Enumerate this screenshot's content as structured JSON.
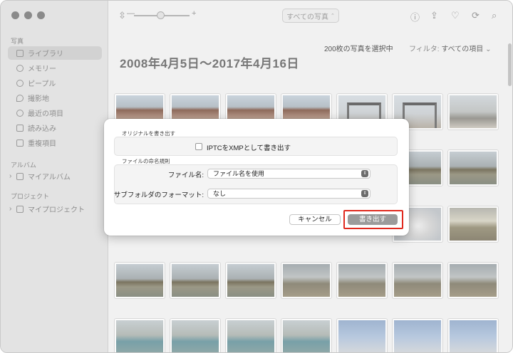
{
  "sidebar": {
    "section_library": "写真",
    "library_items": [
      {
        "label": "ライブラリ",
        "icon": "photo-library-icon"
      },
      {
        "label": "メモリー",
        "icon": "memories-icon"
      },
      {
        "label": "ピープル",
        "icon": "people-icon"
      },
      {
        "label": "撮影地",
        "icon": "location-pin-icon"
      },
      {
        "label": "最近の項目",
        "icon": "clock-icon"
      },
      {
        "label": "読み込み",
        "icon": "import-icon"
      },
      {
        "label": "重複項目",
        "icon": "duplicates-icon"
      }
    ],
    "section_albums": "アルバム",
    "my_albums": "マイアルバム",
    "section_projects": "プロジェクト",
    "my_projects": "マイプロジェクト"
  },
  "toolbar": {
    "zoom_minus": "—",
    "zoom_plus": "+",
    "view_select": "すべての写真"
  },
  "main": {
    "selection_info": "200枚の写真を選択中",
    "filter_label": "フィルタ:",
    "filter_value": "すべての項目",
    "date_range": "2008年4月5日〜2017年4月16日"
  },
  "dialog": {
    "original_group_label": "オリジナルを書き出す",
    "iptc_checkbox_label": "IPTCをXMPとして書き出す",
    "iptc_checked": false,
    "naming_group_label": "ファイルの命名規則",
    "filename_label": "ファイル名:",
    "filename_value": "ファイル名を使用",
    "subfolder_label": "サブフォルダのフォーマット:",
    "subfolder_value": "なし",
    "cancel_label": "キャンセル",
    "export_label": "書き出す"
  },
  "colors": {
    "highlight": "#e0291e",
    "export_button": "#9b9b9b"
  }
}
